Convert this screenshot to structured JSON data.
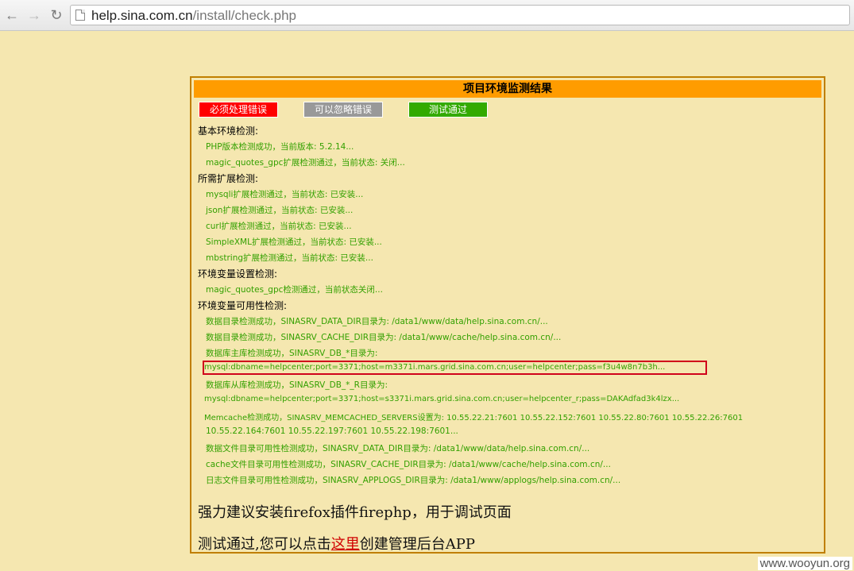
{
  "browser": {
    "url_host": "help.sina.com.cn",
    "url_path": "/install/check.php",
    "back_glyph": "←",
    "forward_glyph": "→",
    "reload_glyph": "↻"
  },
  "panel": {
    "title": "项目环境监测结果",
    "legend": {
      "error": "必须处理错误",
      "ignorable": "可以忽略错误",
      "passed": "测试通过"
    },
    "legend_colors": {
      "error": "#ff0000",
      "ignorable": "#999999",
      "passed": "#33aa00"
    },
    "sections": {
      "basic": {
        "heading": "基本环境检测:",
        "items": [
          "PHP版本检测成功，当前版本: 5.2.14...",
          "magic_quotes_gpc扩展检测通过，当前状态: 关闭..."
        ]
      },
      "extensions": {
        "heading": "所需扩展检测:",
        "items": [
          "mysqli扩展检测通过，当前状态: 已安装...",
          "json扩展检测通过，当前状态: 已安装...",
          "curl扩展检测通过，当前状态: 已安装...",
          "SimpleXML扩展检测通过，当前状态: 已安装...",
          "mbstring扩展检测通过，当前状态: 已安装..."
        ]
      },
      "env_settings": {
        "heading": "环境变量设置检测:",
        "items": [
          "magic_quotes_gpc检测通过，当前状态关闭..."
        ]
      },
      "env_availability": {
        "heading": "环境变量可用性检测:",
        "items": [
          "数据目录检测成功，SINASRV_DATA_DIR目录为: /data1/www/data/help.sina.com.cn/...",
          "数据目录检测成功，SINASRV_CACHE_DIR目录为: /data1/www/cache/help.sina.com.cn/...",
          "数据库主库检测成功，SINASRV_DB_*目录为:",
          "mysql:dbname=helpcenter;port=3371;host=m3371i.mars.grid.sina.com.cn;user=helpcenter;pass=f3u4w8n7b3h...",
          "数据库从库检测成功，SINASRV_DB_*_R目录为:",
          "mysql:dbname=helpcenter;port=3371;host=s3371i.mars.grid.sina.com.cn;user=helpcenter_r;pass=DAKAdfad3k4lzx...",
          "Memcache检测成功，SINASRV_MEMCACHED_SERVERS设置为: 10.55.22.21:7601 10.55.22.152:7601 10.55.22.80:7601 10.55.22.26:7601",
          "10.55.22.164:7601 10.55.22.197:7601 10.55.22.198:7601...",
          "数据文件目录可用性检测成功，SINASRV_DATA_DIR目录为: /data1/www/data/help.sina.com.cn/...",
          "cache文件目录可用性检测成功，SINASRV_CACHE_DIR目录为: /data1/www/cache/help.sina.com.cn/...",
          "日志文件目录可用性检测成功，SINASRV_APPLOGS_DIR目录为: /data1/www/applogs/help.sina.com.cn/..."
        ]
      }
    },
    "firephp_tip": "强力建议安装firefox插件firephp，用于调试页面",
    "passed_msg_before": "测试通过,您可以点击",
    "passed_msg_link": "这里",
    "passed_msg_after": "创建管理后台APP"
  },
  "watermark": "www.wooyun.org"
}
